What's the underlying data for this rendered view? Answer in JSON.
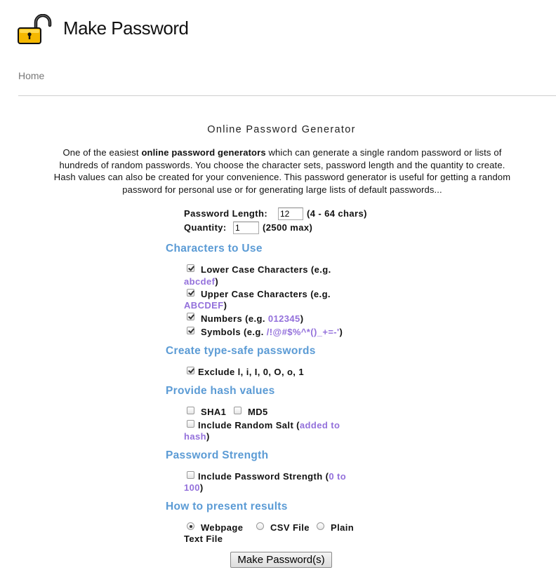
{
  "header": {
    "title": "Make Password",
    "logo_icon": "open-padlock-icon"
  },
  "nav": {
    "home": "Home"
  },
  "main": {
    "heading": "Online Password Generator",
    "intro": {
      "pre": "One of the easiest ",
      "bold": "online password generators",
      "post_line1": " which can generate a single random password or lists of",
      "line2": "hundreds of random passwords. You choose the character sets, password length and the quantity to create.",
      "line3": "Hash values can also be created for your convenience. This password generator is useful for getting a random",
      "line4": "password for personal use or for generating large lists of default passwords..."
    }
  },
  "form": {
    "length_label": "Password Length:",
    "length_value": "12",
    "length_hint": "(4 - 64 chars)",
    "quantity_label": "Quantity:",
    "quantity_value": "1",
    "quantity_hint": "(2500 max)",
    "sections": {
      "chars": "Characters to Use",
      "typesafe": "Create type-safe passwords",
      "hash": "Provide hash values",
      "strength": "Password Strength",
      "present": "How to present results"
    },
    "lower": {
      "label": "Lower Case Characters (e.g.",
      "example": "abcdef",
      "close": ")",
      "checked": true
    },
    "upper": {
      "label": "Upper Case Characters (e.g.",
      "example": "ABCDEF",
      "close": ")",
      "checked": true
    },
    "numbers": {
      "label": "Numbers (e.g.",
      "example": "012345",
      "close": ")",
      "checked": true
    },
    "symbols": {
      "label": "Symbols (e.g.",
      "example": "/!@#$%^*()_+=-'",
      "close": ")",
      "checked": true
    },
    "exclude": {
      "label": "Exclude l, i, I, 0, O, o, 1",
      "checked": true
    },
    "sha1": {
      "label": "SHA1",
      "checked": false
    },
    "md5": {
      "label": "MD5",
      "checked": false
    },
    "salt": {
      "label": "Include Random Salt (",
      "example1": "added to",
      "example2": "hash",
      "close": ")",
      "checked": false
    },
    "strength": {
      "label": "Include Password Strength (",
      "example1": "0 to",
      "example2": "100",
      "close": ")",
      "checked": false
    },
    "output": {
      "webpage": "Webpage",
      "csv": "CSV File",
      "plain1": "Plain",
      "plain2": "Text File",
      "selected": "Webpage"
    },
    "submit_label": "Make Password(s)"
  },
  "colors": {
    "section_heading": "#5b9bd5",
    "example_text": "#9370db",
    "logo_body": "#f5b800"
  }
}
